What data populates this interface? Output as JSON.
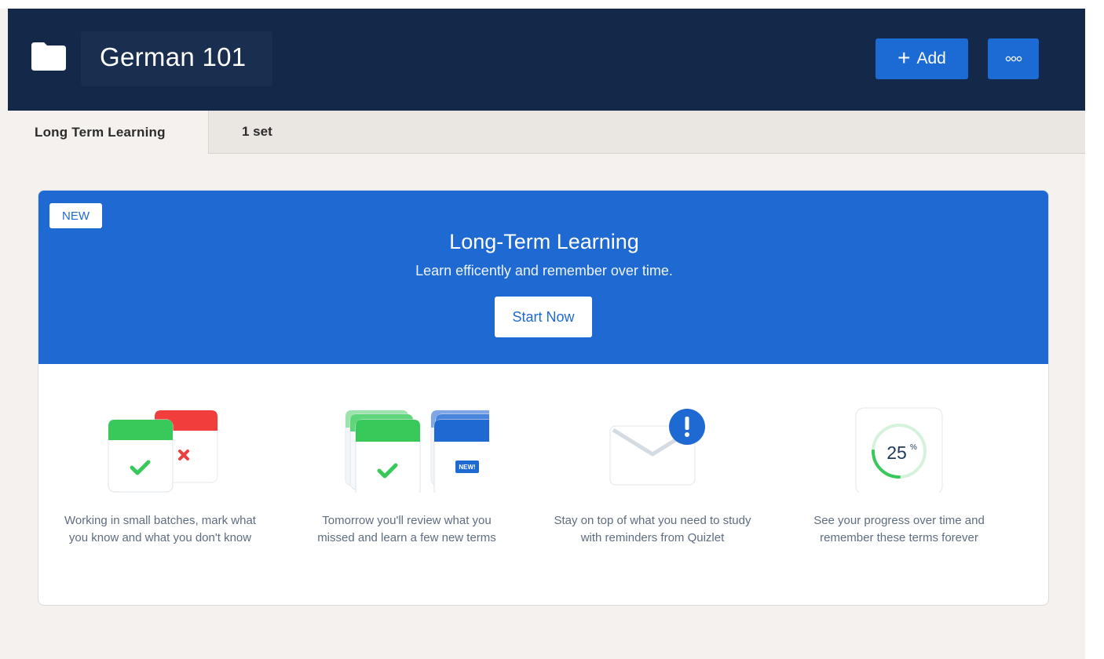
{
  "header": {
    "folder_icon": "folder-icon",
    "title": "German 101",
    "add_label": "Add",
    "add_icon": "plus-icon",
    "more_icon": "more-dots-icon"
  },
  "tabs": {
    "active_label": "Long Term Learning",
    "count_label": "1 set"
  },
  "promo": {
    "badge": "NEW",
    "title": "Long-Term Learning",
    "subtitle": "Learn efficently and remember over time.",
    "cta": "Start Now",
    "features": [
      {
        "icon": "flashcards-check-x-icon",
        "text": "Working in small batches, mark what you know and what you don't know"
      },
      {
        "icon": "stacked-cards-icon",
        "card_badge": "NEW!",
        "text": "Tomorrow you'll review what you missed and learn a few new terms"
      },
      {
        "icon": "envelope-alert-icon",
        "text": "Stay on top of what you need to study with reminders from Quizlet"
      },
      {
        "icon": "progress-ring-icon",
        "progress_value": "25",
        "progress_unit": "%",
        "progress_fraction": 0.25,
        "text": "See your progress over time and remember these terms forever"
      }
    ]
  },
  "colors": {
    "header_bg": "#14284a",
    "accent_blue": "#1e6ad2",
    "button_blue": "#1c6bd4",
    "green": "#39c95b",
    "red": "#f23d3d",
    "page_bg": "#f4f1ee"
  }
}
